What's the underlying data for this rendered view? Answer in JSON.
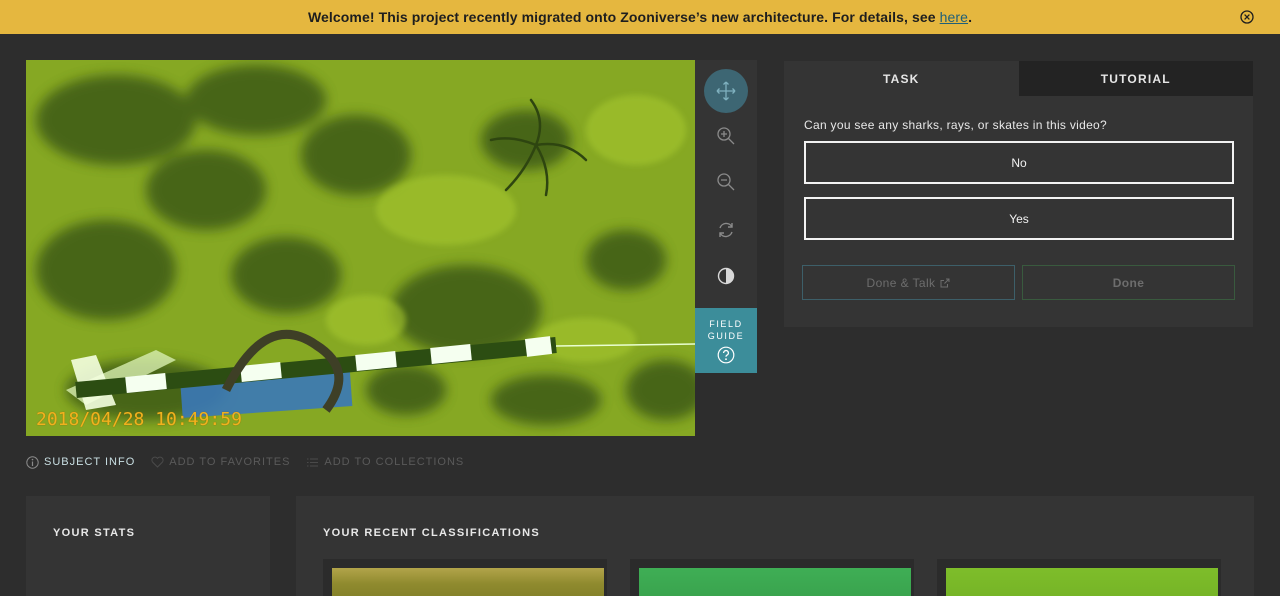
{
  "banner": {
    "text": "Welcome! This project recently migrated onto Zooniverse’s new architecture. For details, see ",
    "link_text": "here",
    "suffix": "."
  },
  "viewer": {
    "timestamp": "2018/04/28 10:49:59",
    "tools": [
      "move-icon",
      "zoom-in-icon",
      "zoom-out-icon",
      "rotate-icon",
      "invert-icon"
    ],
    "field_guide_label": "FIELD GUIDE"
  },
  "meta": {
    "subject_info": "SUBJECT INFO",
    "add_favorites": "ADD TO FAVORITES",
    "add_collections": "ADD TO COLLECTIONS"
  },
  "task": {
    "tabs": [
      {
        "label": "TASK",
        "active": true
      },
      {
        "label": "TUTORIAL",
        "active": false
      }
    ],
    "question": "Can you see any sharks, rays, or skates in this video?",
    "answers": [
      "No",
      "Yes"
    ],
    "done_talk_label": "Done & Talk",
    "done_label": "Done"
  },
  "stats": {
    "heading": "YOUR STATS"
  },
  "recent": {
    "heading": "YOUR RECENT CLASSIFICATIONS"
  },
  "colors": {
    "banner": "#e5b73f",
    "page_bg": "#2d2d2d",
    "panel_bg": "#343434",
    "field_guide": "#3c8d9a",
    "active_tool": "#3d6673",
    "timestamp": "#f0b21e"
  }
}
